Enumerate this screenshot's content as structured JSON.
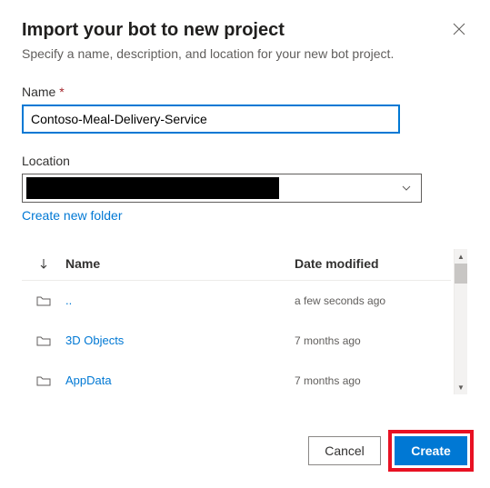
{
  "header": {
    "title": "Import your bot to new project",
    "subtitle": "Specify a name, description, and location for your new bot project."
  },
  "fields": {
    "name_label": "Name",
    "name_value": "Contoso-Meal-Delivery-Service",
    "location_label": "Location",
    "location_value": "",
    "create_folder_link": "Create new folder"
  },
  "browser": {
    "columns": {
      "name": "Name",
      "date": "Date modified"
    },
    "rows": [
      {
        "name": "..",
        "date": "a few seconds ago"
      },
      {
        "name": "3D Objects",
        "date": "7 months ago"
      },
      {
        "name": "AppData",
        "date": "7 months ago"
      }
    ]
  },
  "footer": {
    "cancel": "Cancel",
    "create": "Create"
  }
}
